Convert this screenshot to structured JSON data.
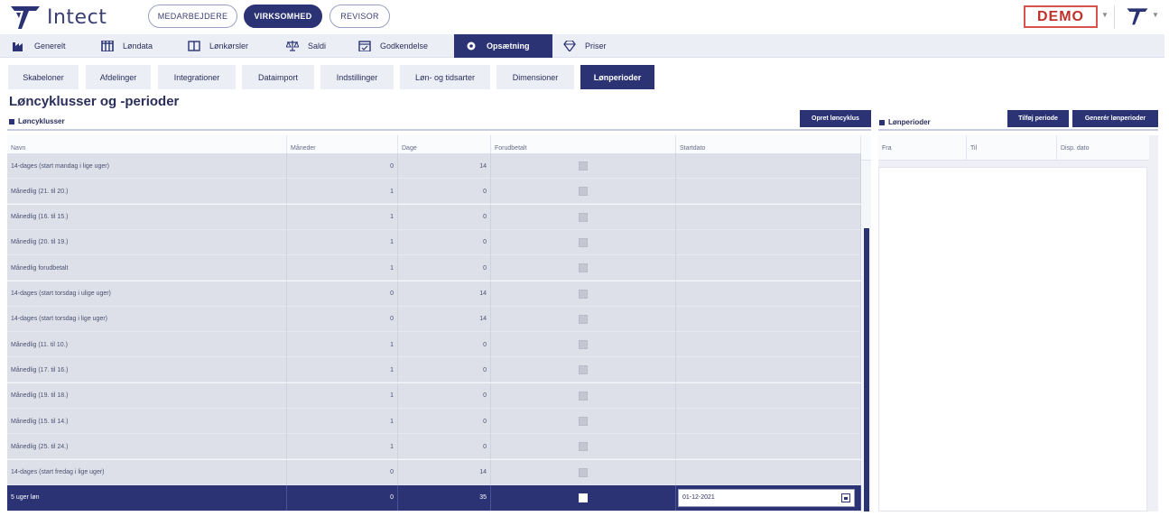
{
  "app": {
    "name": "Intect",
    "roles": [
      "MEDARBEJDERE",
      "VIRKSOMHED",
      "REVISOR"
    ],
    "active_role": "VIRKSOMHED",
    "demo_label": "DEMO"
  },
  "mainnav": {
    "items": [
      {
        "label": "Generelt",
        "icon": "factory-icon"
      },
      {
        "label": "Løndata",
        "icon": "table-icon"
      },
      {
        "label": "Lønkørsler",
        "icon": "book-icon"
      },
      {
        "label": "Saldi",
        "icon": "scale-icon"
      },
      {
        "label": "Godkendelse",
        "icon": "calendar-check-icon"
      },
      {
        "label": "Opsætning",
        "icon": "gear-icon"
      },
      {
        "label": "Priser",
        "icon": "diamond-icon"
      }
    ],
    "active": "Opsætning"
  },
  "subnav": {
    "tabs": [
      "Skabeloner",
      "Afdelinger",
      "Integrationer",
      "Dataimport",
      "Indstillinger",
      "Løn- og tidsarter",
      "Dimensioner",
      "Lønperioder"
    ],
    "active": "Lønperioder"
  },
  "page": {
    "title": "Løncyklusser og -perioder"
  },
  "cycles": {
    "section_title": "Løncyklusser",
    "create_button": "Opret løncyklus",
    "columns": [
      "Navn",
      "Måneder",
      "Dage",
      "Forudbetalt",
      "Startdato"
    ],
    "rows": [
      {
        "name": "14-dages (start mandag i lige uger)",
        "months": "0",
        "days": "14"
      },
      {
        "name": "Månedlig (21. til 20.)",
        "months": "1",
        "days": "0"
      },
      {
        "name": "Månedlig (16. til 15.)",
        "months": "1",
        "days": "0"
      },
      {
        "name": "Månedlig (20. til 19.)",
        "months": "1",
        "days": "0"
      },
      {
        "name": "Månedlig forudbetalt",
        "months": "1",
        "days": "0"
      },
      {
        "name": "14-dages (start torsdag i ulige uger)",
        "months": "0",
        "days": "14"
      },
      {
        "name": "14-dages (start torsdag i lige uger)",
        "months": "0",
        "days": "14"
      },
      {
        "name": "Månedlig (11. til 10.)",
        "months": "1",
        "days": "0"
      },
      {
        "name": "Månedlig (17. til 16.)",
        "months": "1",
        "days": "0"
      },
      {
        "name": "Månedlig (19. til 18.)",
        "months": "1",
        "days": "0"
      },
      {
        "name": "Månedlig (15. til 14.)",
        "months": "1",
        "days": "0"
      },
      {
        "name": "Månedlig (25. til 24.)",
        "months": "1",
        "days": "0"
      },
      {
        "name": "14-dages (start fredag i lige uger)",
        "months": "0",
        "days": "14"
      }
    ],
    "selected_row": {
      "name": "5 uger løn",
      "months": "0",
      "days": "35",
      "start_date": "01-12-2021"
    }
  },
  "periods": {
    "section_title": "Lønperioder",
    "add_button": "Tilføj periode",
    "generate_button": "Generér lønperioder",
    "columns": [
      "Fra",
      "Til",
      "Disp. dato"
    ]
  },
  "colors": {
    "primary": "#2b3375",
    "nav_bg": "#eceef6",
    "demo_red": "#d9534f"
  }
}
